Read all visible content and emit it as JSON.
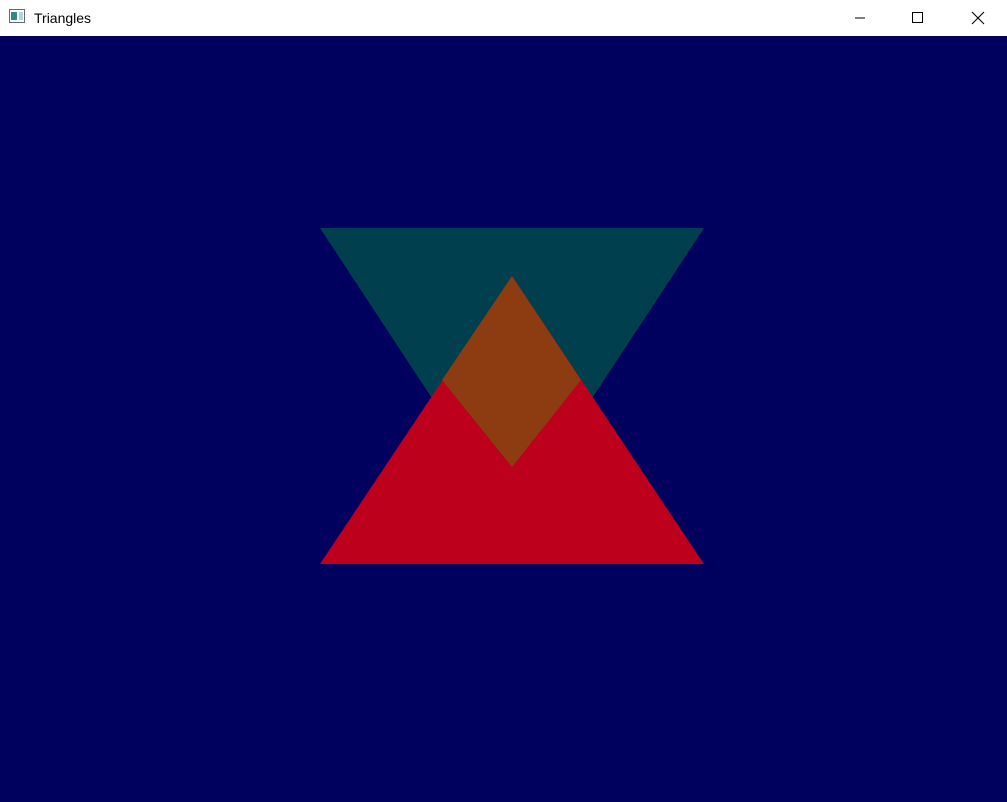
{
  "window": {
    "title": "Triangles",
    "controls": {
      "minimize": "minimize-icon",
      "maximize": "maximize-icon",
      "close": "close-icon"
    }
  },
  "scene": {
    "background_color": "#00005f",
    "shapes": [
      {
        "name": "teal-inverted-triangle",
        "color": "#003f4d"
      },
      {
        "name": "red-triangle",
        "color": "#bd001c"
      },
      {
        "name": "overlap-diamond",
        "color": "#8c3c10"
      }
    ]
  }
}
